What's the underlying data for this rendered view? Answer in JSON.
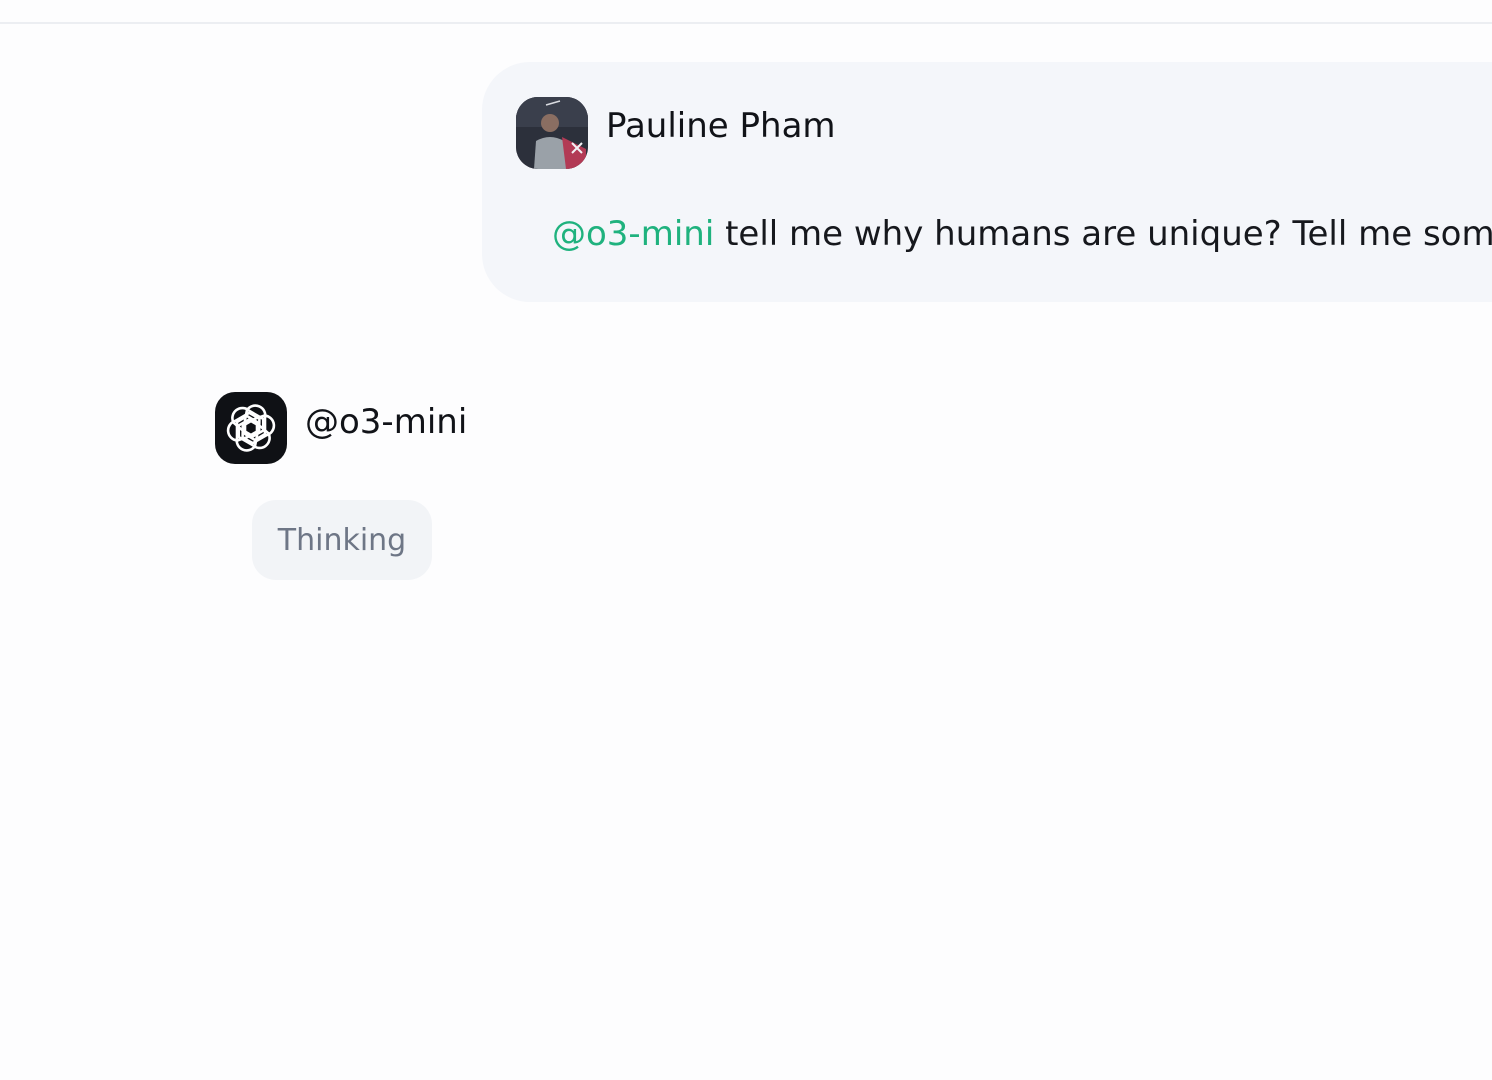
{
  "conversation": {
    "user_message": {
      "author": "Pauline Pham",
      "avatar": "user-photo-avatar",
      "mention": "@o3-mini",
      "text": " tell me why humans are unique? Tell me somet"
    },
    "bot_message": {
      "name": "@o3-mini",
      "avatar": "openai-logo-icon",
      "status": "Thinking"
    }
  },
  "colors": {
    "mention": "#1fb27e",
    "user_bubble": "#f4f6fa",
    "thinking_pill": "#f2f4f7",
    "bot_avatar_bg": "#0f1115"
  }
}
